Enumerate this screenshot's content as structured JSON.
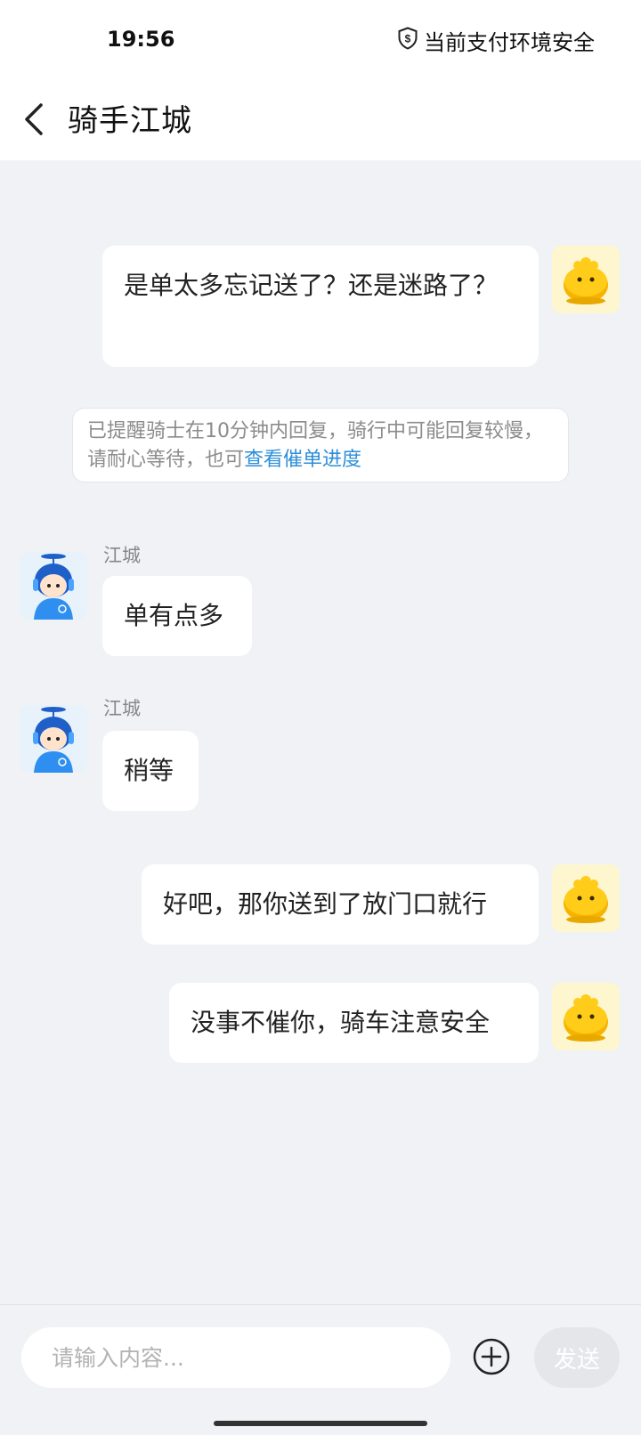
{
  "status_bar": {
    "time": "19:56",
    "security_icon": "shield-dollar-icon",
    "security_text": "当前支付环境安全"
  },
  "header": {
    "back_icon": "chevron-left-icon",
    "title": "骑手江城"
  },
  "messages": {
    "m1": {
      "sender": "user",
      "text": "是单太多忘记送了？还是迷路了？"
    },
    "notice": {
      "text": "已提醒骑士在10分钟内回复，骑行中可能回复较慢，请耐心等待，也可",
      "link": "查看催单进度"
    },
    "m2": {
      "sender": "rider",
      "name": "江城",
      "text": "单有点多"
    },
    "m3": {
      "sender": "rider",
      "name": "江城",
      "text": "稍等"
    },
    "m4": {
      "sender": "user",
      "text": "好吧，那你送到了放门口就行"
    },
    "m5": {
      "sender": "user",
      "text": "没事不催你，骑车注意安全"
    }
  },
  "input_bar": {
    "placeholder": "请输入内容...",
    "plus_icon": "plus-circle-icon",
    "send_label": "发送"
  },
  "colors": {
    "background": "#f0f2f6",
    "bubble": "#ffffff",
    "link": "#2d8fd8",
    "user_avatar_bg": "#fdf6cf",
    "rider_avatar_bg": "#e8f2fb"
  }
}
